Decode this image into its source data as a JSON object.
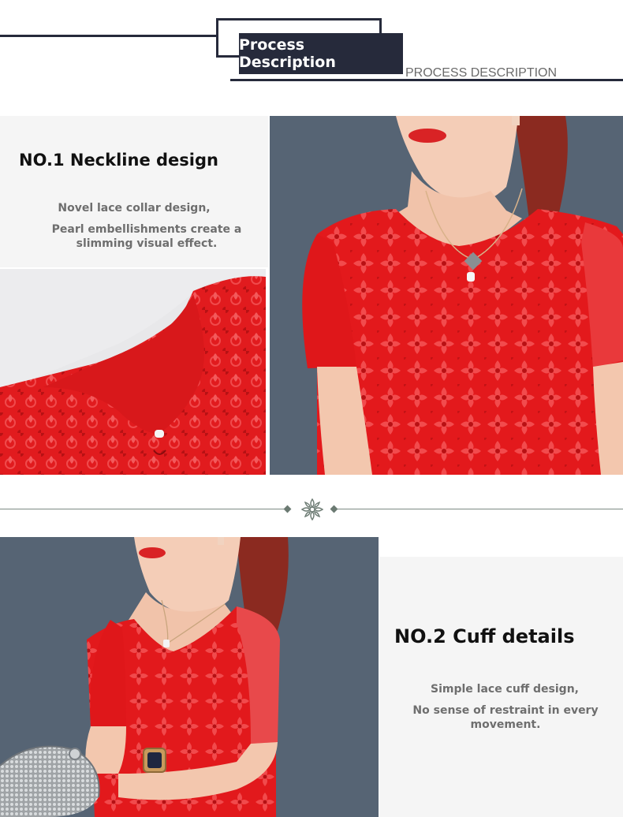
{
  "header": {
    "title": "Process Description",
    "subtitle": "PROCESS DESCRIPTION"
  },
  "section1": {
    "title": "NO.1 Neckline design",
    "desc_line1": "Novel lace collar design,",
    "desc_line2": "Pearl embellishments create a slimming visual effect."
  },
  "section2": {
    "title": "NO.2 Cuff details",
    "desc_line1": "Simple lace cuff design,",
    "desc_line2": "No sense of restraint in every movement."
  },
  "colors": {
    "navy": "#262a3b",
    "red_dress": "#e01a1d",
    "panel_bg": "#f5f5f5",
    "backdrop": "#566474",
    "text_gray": "#6e6e6e"
  }
}
